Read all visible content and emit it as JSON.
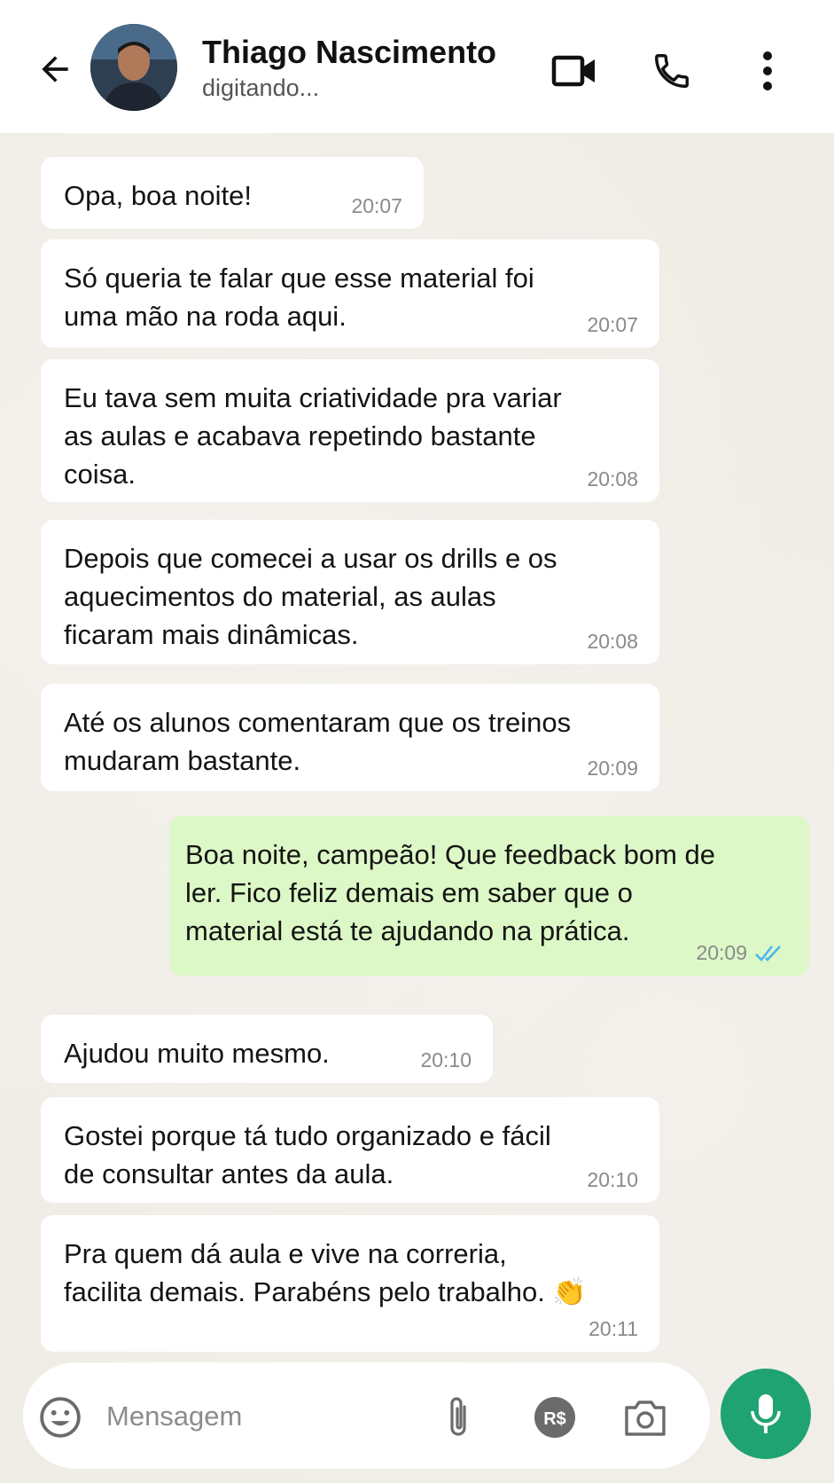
{
  "header": {
    "contact_name": "Thiago Nascimento",
    "status": "digitando..."
  },
  "messages": [
    {
      "direction": "in",
      "text": "Opa, boa noite!",
      "time": "20:07"
    },
    {
      "direction": "in",
      "text": "Só queria te falar que esse material foi\numa mão na roda aqui.",
      "time": "20:07"
    },
    {
      "direction": "in",
      "text": "Eu tava sem muita criatividade pra variar\nas aulas e acabava repetindo bastante\ncoisa.",
      "time": "20:08"
    },
    {
      "direction": "in",
      "text": "Depois que comecei a usar os drills e os\naquecimentos do material, as aulas\nficaram mais dinâmicas.",
      "time": "20:08"
    },
    {
      "direction": "in",
      "text": "Até os alunos comentaram que os treinos\nmudaram bastante.",
      "time": "20:09"
    },
    {
      "direction": "out",
      "text": "Boa noite, campeão! Que feedback bom de\nler. Fico feliz demais em saber que o\nmaterial está te ajudando na prática.",
      "time": "20:09",
      "status": "read"
    },
    {
      "direction": "in",
      "text": "Ajudou muito mesmo.",
      "time": "20:10"
    },
    {
      "direction": "in",
      "text": "Gostei porque tá tudo organizado e fácil\nde consultar antes da aula.",
      "time": "20:10"
    },
    {
      "direction": "in",
      "text": "Pra quem dá aula e vive na correria,\nfacilita demais. Parabéns pelo trabalho. 👏",
      "time": "20:11"
    }
  ],
  "composer": {
    "placeholder": "Mensagem"
  },
  "icons": {
    "back": "arrow-left-icon",
    "video": "video-call-icon",
    "call": "phone-icon",
    "menu": "more-vertical-icon",
    "emoji": "emoji-icon",
    "attach": "paperclip-icon",
    "payment": "payment-icon",
    "camera": "camera-icon",
    "mic": "microphone-icon"
  },
  "colors": {
    "outgoing_bubble": "#dcf8c6",
    "incoming_bubble": "#ffffff",
    "mic_button": "#1fa372",
    "read_ticks": "#4fb6ec"
  }
}
